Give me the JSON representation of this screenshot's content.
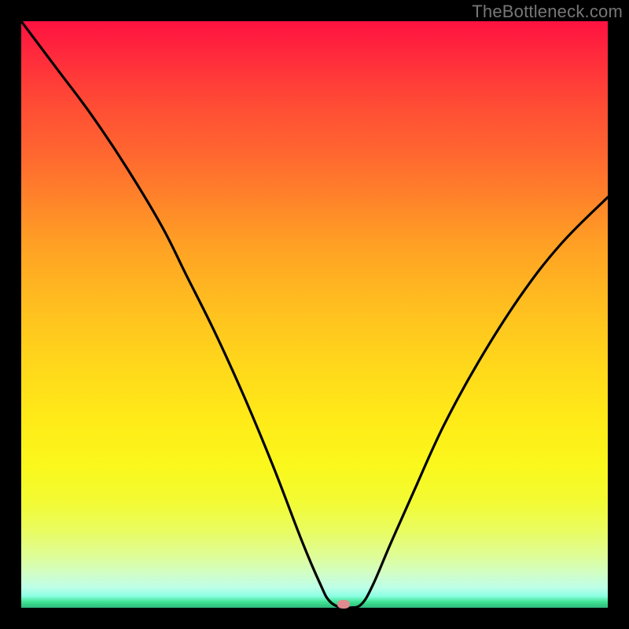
{
  "watermark": "TheBottleneck.com",
  "chart_data": {
    "type": "line",
    "title": "",
    "xlabel": "",
    "ylabel": "",
    "xlim": [
      0,
      100
    ],
    "ylim": [
      0,
      100
    ],
    "grid": false,
    "legend": false,
    "series": [
      {
        "name": "bottleneck-curve",
        "x": [
          0,
          6,
          12,
          18,
          24,
          28,
          33,
          38,
          43,
          48,
          51,
          52.5,
          54.5,
          56,
          58,
          60,
          63,
          67,
          72,
          78,
          85,
          92,
          100
        ],
        "values": [
          100,
          92,
          84,
          75,
          65,
          57,
          47,
          36,
          24,
          11,
          4,
          1.2,
          0,
          0,
          0.6,
          4,
          11,
          20,
          31,
          42,
          53,
          62,
          70
        ]
      }
    ],
    "background_gradient": {
      "top_color": "#FF1241",
      "mid_colors": [
        "#FF822A",
        "#FFD61B",
        "#F2FB34"
      ],
      "bottom_color": "#2FB87D"
    },
    "marker": {
      "x": 55,
      "y": 0,
      "color": "#E08B8F"
    }
  }
}
